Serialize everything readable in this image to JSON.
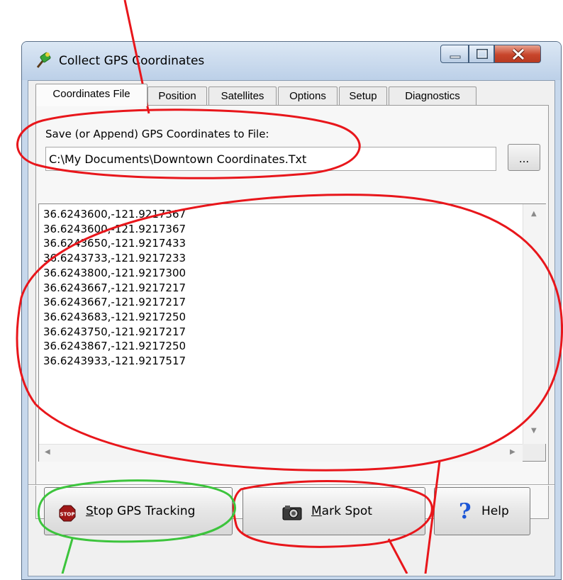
{
  "window": {
    "title": "Collect GPS Coordinates",
    "app_icon": "satellite-icon",
    "controls": [
      "minimize-icon",
      "maximize-icon",
      "close-icon"
    ]
  },
  "tabs": [
    {
      "label": "Coordinates File",
      "active": true
    },
    {
      "label": "Position",
      "active": false
    },
    {
      "label": "Satellites",
      "active": false
    },
    {
      "label": "Options",
      "active": false
    },
    {
      "label": "Setup",
      "active": false
    },
    {
      "label": "Diagnostics",
      "active": false
    }
  ],
  "file": {
    "label": "Save (or Append) GPS Coordinates to File:",
    "value": "C:\\My Documents\\Downtown Coordinates.Txt",
    "browse_label": "..."
  },
  "coordinates": [
    "36.6243600,-121.9217367",
    "36.6243600,-121.9217367",
    "36.6243650,-121.9217433",
    "36.6243733,-121.9217233",
    "36.6243800,-121.9217300",
    "36.6243667,-121.9217217",
    "36.6243667,-121.9217217",
    "36.6243683,-121.9217250",
    "36.6243750,-121.9217217",
    "36.6243867,-121.9217250",
    "36.6243933,-121.9217517"
  ],
  "buttons": {
    "stop": {
      "label_first": "S",
      "label_rest": "top GPS Tracking",
      "icon": "stop-sign-icon"
    },
    "mark": {
      "label_first": "M",
      "label_rest": "ark Spot",
      "icon": "camera-icon"
    },
    "help": {
      "label": "Help",
      "icon": "question-mark-icon"
    }
  },
  "colors": {
    "annotation_red": "#e8161b",
    "annotation_green": "#3cc43c",
    "close_button": "#c8452b",
    "help_icon_blue": "#1c56d6"
  }
}
